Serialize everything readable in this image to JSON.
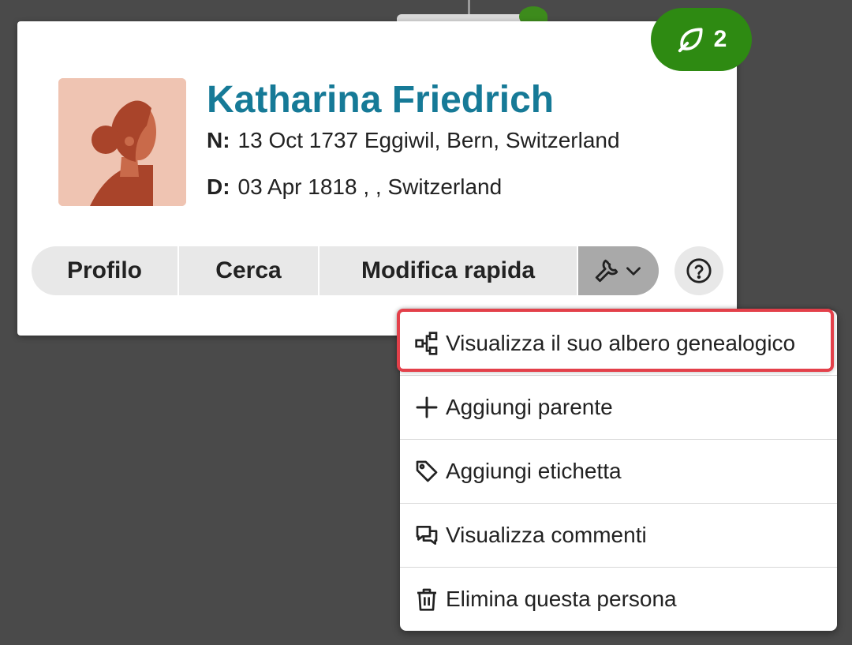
{
  "hint_badge": {
    "count": "2",
    "icon": "leaf-hint-icon",
    "color": "#2e8a12"
  },
  "person": {
    "name": "Katharina Friedrich",
    "birth_label": "N:",
    "birth_value": "13 Oct 1737 Eggiwil, Bern, Switzerland",
    "death_label": "D:",
    "death_value": "03 Apr 1818 , , Switzerland",
    "name_color": "#167a97",
    "avatar": "female-silhouette-avatar"
  },
  "actions": {
    "profile_label": "Profilo",
    "search_label": "Cerca",
    "quick_edit_label": "Modifica rapida",
    "tools_icon": "wrench-icon",
    "help_icon": "help-circle-icon"
  },
  "tools_menu": {
    "items": [
      {
        "label": "Visualizza il suo albero genealogico",
        "icon": "family-tree-icon",
        "highlighted": true
      },
      {
        "label": "Aggiungi parente",
        "icon": "plus-icon"
      },
      {
        "label": "Aggiungi etichetta",
        "icon": "tag-icon"
      },
      {
        "label": "Visualizza commenti",
        "icon": "comments-icon"
      },
      {
        "label": "Elimina questa persona",
        "icon": "trash-icon"
      }
    ],
    "highlight_color": "#e3404a"
  }
}
